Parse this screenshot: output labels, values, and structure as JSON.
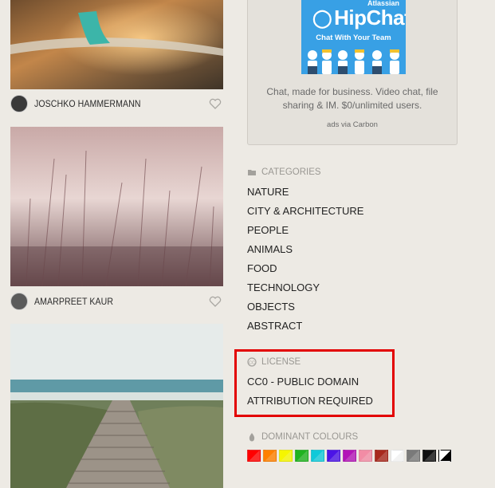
{
  "authors": [
    {
      "name": "JOSCHKO HAMMERMANN"
    },
    {
      "name": "AMARPREET KAUR"
    }
  ],
  "ad": {
    "brand_small": "Atlassian",
    "brand": "HipChat",
    "tagline": "Chat With Your Team",
    "text": "Chat, made for business. Video chat, file sharing & IM. $0/unlimited users.",
    "via": "ads via Carbon"
  },
  "categories": {
    "title": "CATEGORIES",
    "items": [
      "NATURE",
      "CITY & ARCHITECTURE",
      "PEOPLE",
      "ANIMALS",
      "FOOD",
      "TECHNOLOGY",
      "OBJECTS",
      "ABSTRACT"
    ]
  },
  "license": {
    "title": "LICENSE",
    "items": [
      "CC0 - PUBLIC DOMAIN",
      "ATTRIBUTION REQUIRED"
    ]
  },
  "colours": {
    "title": "DOMINANT COLOURS",
    "swatches": [
      {
        "name": "red",
        "color": "#ff0000"
      },
      {
        "name": "orange",
        "color": "#ff8000"
      },
      {
        "name": "yellow",
        "color": "#f6f600"
      },
      {
        "name": "green",
        "color": "#1fb31f"
      },
      {
        "name": "turquoise",
        "color": "#10c9d9"
      },
      {
        "name": "blue",
        "color": "#4b14e6"
      },
      {
        "name": "violet",
        "color": "#b315b8"
      },
      {
        "name": "pink",
        "color": "#f28ca5"
      },
      {
        "name": "brown",
        "color": "#a82a1e"
      },
      {
        "name": "white",
        "color": "#ffffff"
      },
      {
        "name": "gray",
        "color": "#7a7a7a"
      },
      {
        "name": "black",
        "color": "#111111"
      },
      {
        "name": "black-and-white",
        "color": "#000000"
      }
    ]
  },
  "highlight_color": "#e30000"
}
